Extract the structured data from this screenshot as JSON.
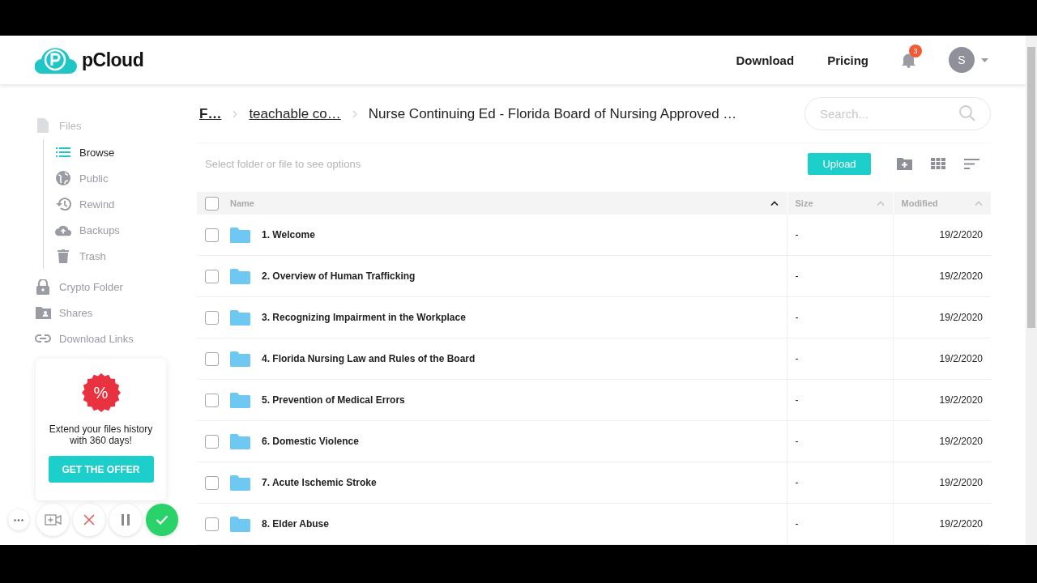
{
  "header": {
    "logo": "pCloud",
    "nav": [
      "Download",
      "Pricing"
    ],
    "notifications": {
      "count": "3"
    },
    "avatar": {
      "initial": "S"
    }
  },
  "sidebar": {
    "items": [
      {
        "label": "Files",
        "selected": false,
        "children": [
          {
            "label": "Browse",
            "selected": true
          },
          {
            "label": "Public",
            "selected": false
          },
          {
            "label": "Rewind",
            "selected": false
          },
          {
            "label": "Backups",
            "selected": false
          },
          {
            "label": "Trash",
            "selected": false
          }
        ]
      },
      {
        "label": "Crypto Folder",
        "selected": false
      },
      {
        "label": "Shares",
        "selected": false
      },
      {
        "label": "Download Links",
        "selected": false
      }
    ]
  },
  "breadcrumb": [
    {
      "label": "F…",
      "kind": "root"
    },
    {
      "label": "teachable co…",
      "kind": "link"
    },
    {
      "label": "Nurse Continuing Ed - Florida Board of Nursing Approved …",
      "kind": "current"
    }
  ],
  "search": {
    "placeholder": "Search..."
  },
  "toolbar": {
    "hint": "Select folder or file to see options",
    "upload": "Upload"
  },
  "table": {
    "select_all": {
      "checked": false
    },
    "columns": [
      {
        "label": "Name",
        "sorted": true
      },
      {
        "label": "Size",
        "sorted": false
      },
      {
        "label": "Modified",
        "sorted": false
      }
    ],
    "rows": [
      {
        "checked": false,
        "name": "1. Welcome",
        "size": "-",
        "modified": "19/2/2020"
      },
      {
        "checked": false,
        "name": "2. Overview of Human Trafficking",
        "size": "-",
        "modified": "19/2/2020"
      },
      {
        "checked": false,
        "name": "3. Recognizing Impairment in the Workplace",
        "size": "-",
        "modified": "19/2/2020"
      },
      {
        "checked": false,
        "name": "4. Florida Nursing Law and Rules of the Board",
        "size": "-",
        "modified": "19/2/2020"
      },
      {
        "checked": false,
        "name": "5. Prevention of Medical Errors",
        "size": "-",
        "modified": "19/2/2020"
      },
      {
        "checked": false,
        "name": "6. Domestic Violence",
        "size": "-",
        "modified": "19/2/2020"
      },
      {
        "checked": false,
        "name": "7. Acute Ischemic Stroke",
        "size": "-",
        "modified": "19/2/2020"
      },
      {
        "checked": false,
        "name": "8. Elder Abuse",
        "size": "-",
        "modified": "19/2/2020"
      }
    ]
  },
  "promo": {
    "badge": "%",
    "text": "Extend your files history with 360 days!",
    "button": "GET THE OFFER"
  }
}
